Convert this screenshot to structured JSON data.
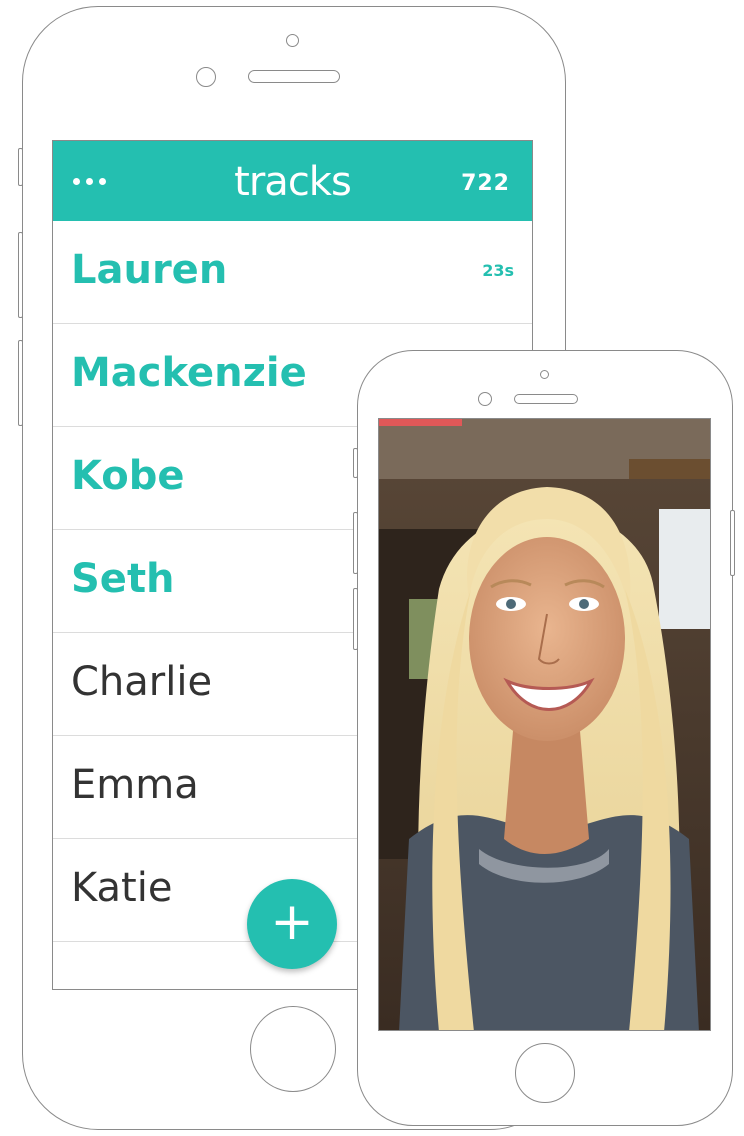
{
  "app": {
    "title": "tracks",
    "count": "722"
  },
  "contacts": [
    {
      "name": "Lauren",
      "meta": "23s",
      "unread": true
    },
    {
      "name": "Mackenzie",
      "meta": "",
      "unread": true
    },
    {
      "name": "Kobe",
      "meta": "",
      "unread": true
    },
    {
      "name": "Seth",
      "meta": "",
      "unread": true
    },
    {
      "name": "Charlie",
      "meta": "",
      "unread": false
    },
    {
      "name": "Emma",
      "meta": "",
      "unread": false
    },
    {
      "name": "Katie",
      "meta": "",
      "unread": false
    }
  ],
  "fab": {
    "label": "+"
  },
  "video": {
    "progress": 0.25
  },
  "icons": {
    "menu": "more-dots-icon",
    "add": "plus-icon"
  },
  "colors": {
    "accent": "#24bfb0",
    "progress": "#e05858",
    "text_dark": "#333333"
  }
}
